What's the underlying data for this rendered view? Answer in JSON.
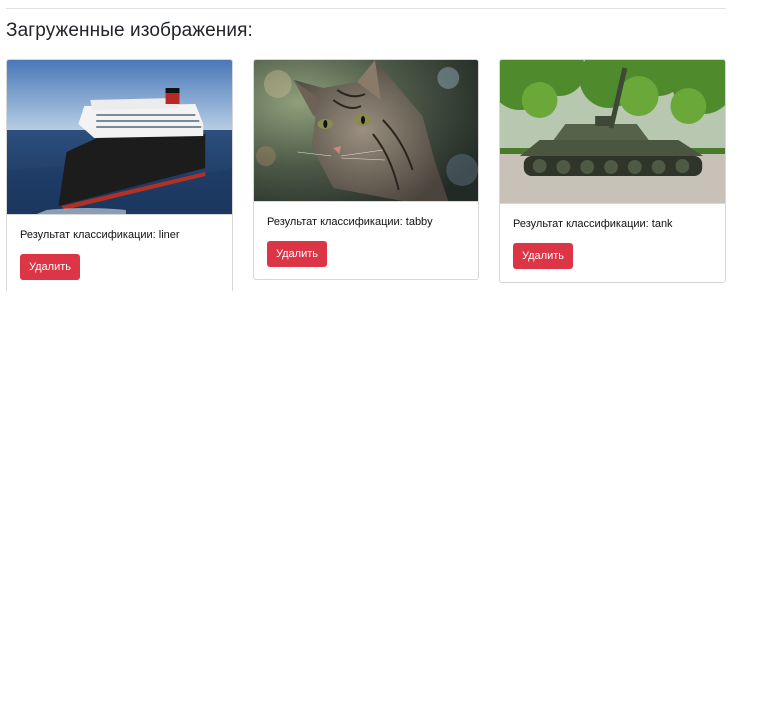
{
  "section_title": "Загруженные изображения:",
  "cards": [
    {
      "image_label": "liner",
      "caption": "Результат классификации: liner",
      "delete_label": "Удалить"
    },
    {
      "image_label": "tabby",
      "caption": "Результат классификации: tabby",
      "delete_label": "Удалить"
    },
    {
      "image_label": "tank",
      "caption": "Результат классификации: tank",
      "delete_label": "Удалить"
    }
  ],
  "colors": {
    "danger": "#dc3545",
    "border": "#d7d7d7"
  }
}
